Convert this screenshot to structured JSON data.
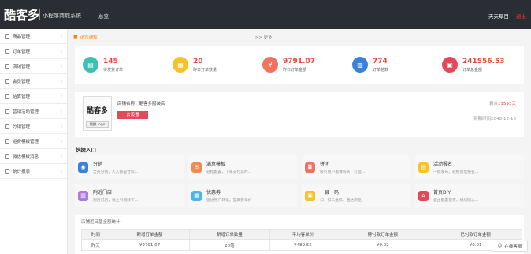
{
  "header": {
    "logo": "酷客多",
    "system_name": "小程序商城系统",
    "home": "总览",
    "user": "天天早目",
    "logout": "退出"
  },
  "sidebar": {
    "items": [
      {
        "label": "商品管理"
      },
      {
        "label": "订单管理"
      },
      {
        "label": "店铺管理"
      },
      {
        "label": "会员管理"
      },
      {
        "label": "结算管理"
      },
      {
        "label": "营销活动管理"
      },
      {
        "label": "分销管理"
      },
      {
        "label": "运费模板管理"
      },
      {
        "label": "微信模板消息"
      },
      {
        "label": "统计报表"
      }
    ]
  },
  "notice": {
    "label": "请您通知:",
    "text": "",
    "more": ">> 更多"
  },
  "stats": [
    {
      "value": "145",
      "label": "待发货订单",
      "color": "#3cc0b4"
    },
    {
      "value": "20",
      "label": "昨日订单数量",
      "color": "#f6c22c"
    },
    {
      "value": "9791.07",
      "label": "昨日订单金额",
      "color": "#f07360"
    },
    {
      "value": "774",
      "label": "订单总数",
      "color": "#3a82d8"
    },
    {
      "value": "241556.53",
      "label": "订单总金额",
      "color": "#e24a5a"
    }
  ],
  "shop": {
    "logo_text": "酷客多",
    "change_logo": "更换 logo",
    "name": "店铺名称：酷客多服装店",
    "setup": "去设置",
    "remain_prefix": "剩余",
    "remain_days": "11593天",
    "expire": "到期时间2048-12-16"
  },
  "quick": {
    "title": "快捷入口",
    "items": [
      {
        "title": "分销",
        "desc": "全员分销，人人都是合伙...",
        "color": "#3a82d8"
      },
      {
        "title": "满意模板",
        "desc": "轻松配置，下单支付实时...",
        "color": "#f08a50"
      },
      {
        "title": "拼团",
        "desc": "吸引用户邀请购买，打造...",
        "color": "#f07360"
      },
      {
        "title": "活动报名",
        "desc": "一键发布，轻松管理报名...",
        "color": "#f6c22c"
      },
      {
        "title": "附近门店",
        "desc": "附近门店，线上引流线下...",
        "color": "#b07be0"
      },
      {
        "title": "优惠券",
        "desc": "促进用户转化，提高客单价",
        "color": "#4ab6e8"
      },
      {
        "title": "一县一码",
        "desc": "扫一扫二维码，直达商品",
        "color": "#f6c22c"
      },
      {
        "title": "首页DIY",
        "desc": "自由配置首页，模块随心...",
        "color": "#e24a5a"
      }
    ]
  },
  "table": {
    "title": "店铺近日基金额统计",
    "headers": [
      "时间",
      "新增订单金额",
      "新增订单数量",
      "平均客单价",
      "待付款订单金额",
      "已付款订单金额"
    ],
    "rows": [
      [
        "昨天",
        "¥9791.07",
        "20笔",
        "¥489.55",
        "¥0.02",
        "¥0.01"
      ]
    ]
  },
  "service": {
    "label": "在线客服"
  }
}
